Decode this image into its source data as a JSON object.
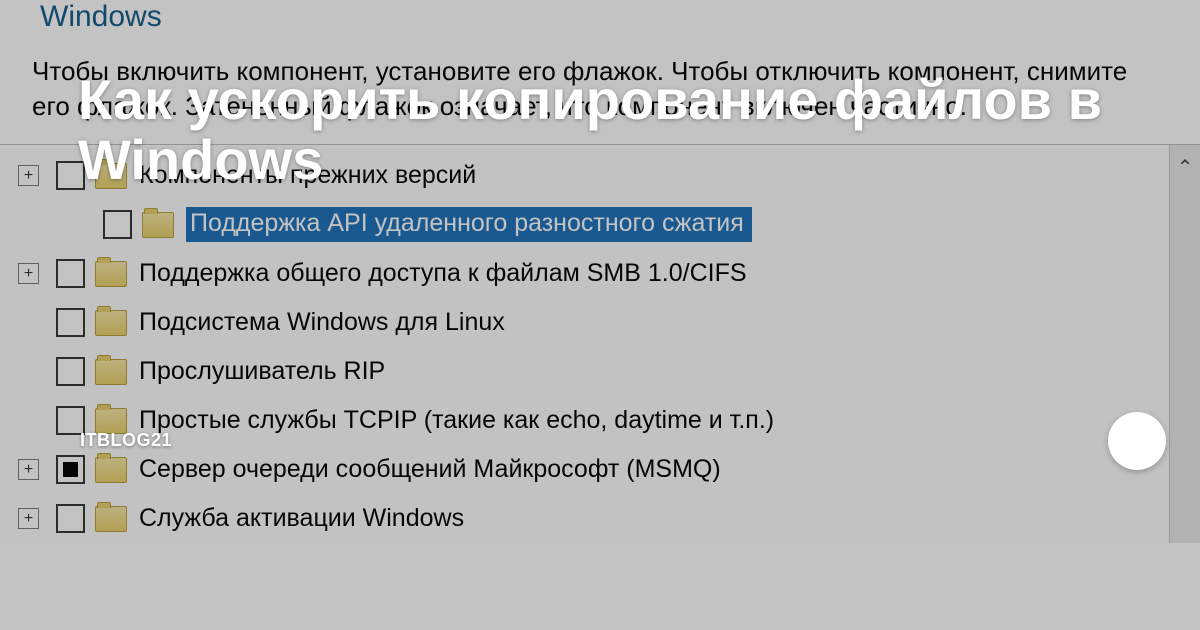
{
  "window": {
    "title_fragment": "Windows",
    "description": "Чтобы включить компонент, установите его флажок. Чтобы отключить компонент, снимите его флажок. Затененный флажок означает, что компонент включен частично."
  },
  "tree": {
    "items": [
      {
        "label": "Компоненты прежних версий",
        "expandable": true,
        "checked": "empty",
        "indent": 0,
        "selected": false
      },
      {
        "label": "Поддержка API удаленного разностного сжатия",
        "expandable": false,
        "checked": "empty",
        "indent": 1,
        "selected": true
      },
      {
        "label": "Поддержка общего доступа к файлам SMB 1.0/CIFS",
        "expandable": true,
        "checked": "empty",
        "indent": 0,
        "selected": false
      },
      {
        "label": "Подсистема Windows для Linux",
        "expandable": false,
        "checked": "empty",
        "indent": 0,
        "selected": false
      },
      {
        "label": "Прослушиватель RIP",
        "expandable": false,
        "checked": "empty",
        "indent": 0,
        "selected": false
      },
      {
        "label": "Простые службы TCPIP (такие как echo, daytime и т.п.)",
        "expandable": false,
        "checked": "empty",
        "indent": 0,
        "selected": false
      },
      {
        "label": "Сервер очереди сообщений Майкрософт (MSMQ)",
        "expandable": true,
        "checked": "partial",
        "indent": 0,
        "selected": false
      },
      {
        "label": "Служба активации Windows",
        "expandable": true,
        "checked": "empty",
        "indent": 0,
        "selected": false
      }
    ]
  },
  "overlay": {
    "headline": "Как ускорить копирование файлов в Windows",
    "author": "ITBLOG21"
  },
  "colors": {
    "selection": "#1a6fb8",
    "accent_red": "#ff0033"
  }
}
